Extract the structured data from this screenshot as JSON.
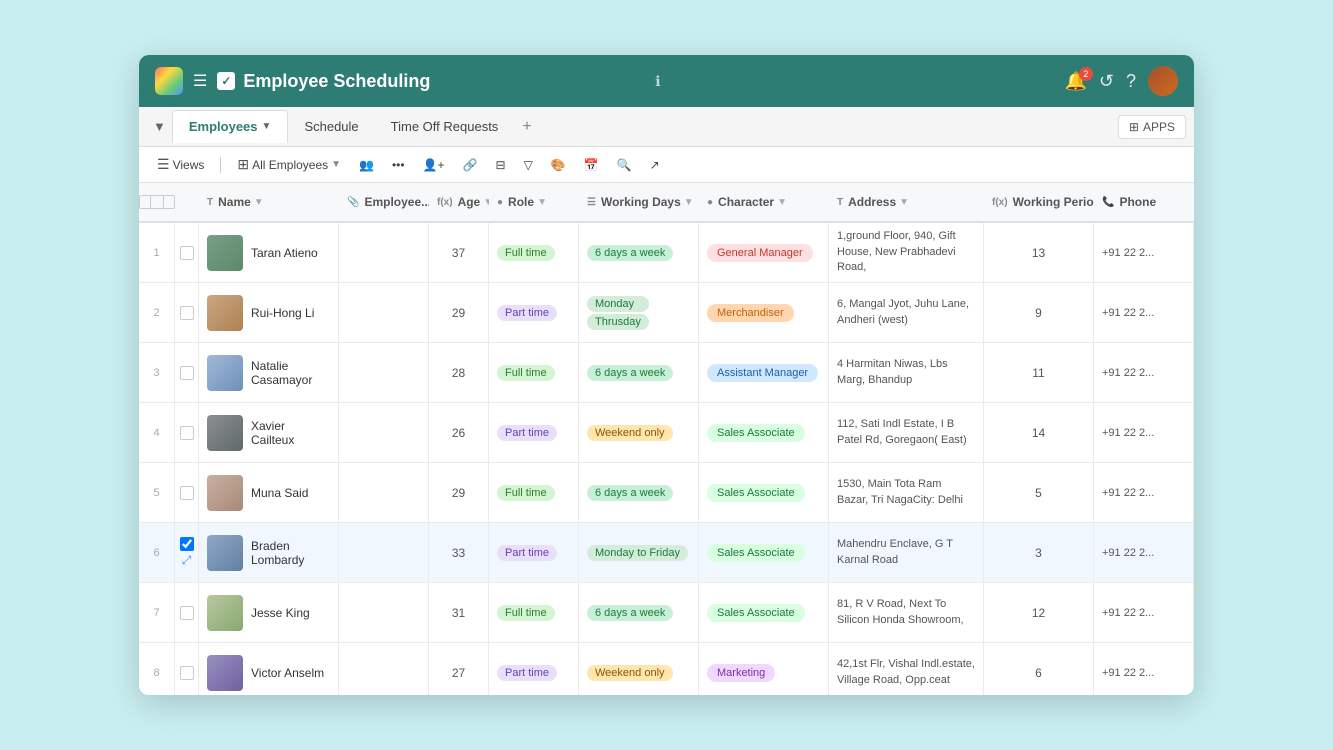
{
  "app": {
    "title": "Employee Scheduling",
    "info_icon": "ℹ",
    "notification_count": "2"
  },
  "tabs": [
    {
      "label": "Employees",
      "active": true
    },
    {
      "label": "Schedule",
      "active": false
    },
    {
      "label": "Time Off Requests",
      "active": false
    }
  ],
  "toolbar": {
    "views_label": "Views",
    "all_employees_label": "All Employees",
    "apps_label": "APPS"
  },
  "columns": [
    {
      "label": "Name",
      "type": "T"
    },
    {
      "label": "Employee...",
      "type": "📎"
    },
    {
      "label": "Age",
      "type": "f(x)"
    },
    {
      "label": "Role",
      "type": "●"
    },
    {
      "label": "Working Days",
      "type": "☰"
    },
    {
      "label": "Character",
      "type": "●"
    },
    {
      "label": "Address",
      "type": "T"
    },
    {
      "label": "Working Period",
      "type": "f(x)"
    },
    {
      "label": "Phone",
      "type": "📞"
    }
  ],
  "rows": [
    {
      "num": "1",
      "name": "Taran Atieno",
      "avatar_class": "av1",
      "age": "37",
      "role": "Full time",
      "role_class": "badge-full",
      "working_days": [
        "6 days a week"
      ],
      "working_classes": [
        "badge-days-6"
      ],
      "character": "General Manager",
      "char_class": "char-general",
      "address": "1,ground Floor, 940, Gift House, New Prabhadevi Road,",
      "period": "13",
      "phone": "+91 22 2..."
    },
    {
      "num": "2",
      "name": "Rui-Hong Li",
      "avatar_class": "av2",
      "age": "29",
      "role": "Part time",
      "role_class": "badge-part",
      "working_days": [
        "Monday",
        "Thrusday"
      ],
      "working_classes": [
        "badge-monday",
        "badge-thursday"
      ],
      "character": "Merchandiser",
      "char_class": "char-merch",
      "address": "6, Mangal Jyot, Juhu Lane, Andheri (west)",
      "period": "9",
      "phone": "+91 22 2..."
    },
    {
      "num": "3",
      "name": "Natalie Casamayor",
      "avatar_class": "av3",
      "age": "28",
      "role": "Full time",
      "role_class": "badge-full",
      "working_days": [
        "6 days a week"
      ],
      "working_classes": [
        "badge-days-6"
      ],
      "character": "Assistant Manager",
      "char_class": "char-asst",
      "address": "4 Harmitan Niwas, Lbs Marg, Bhandup",
      "period": "11",
      "phone": "+91 22 2..."
    },
    {
      "num": "4",
      "name": "Xavier Cailteux",
      "avatar_class": "av4",
      "age": "26",
      "role": "Part time",
      "role_class": "badge-part",
      "working_days": [
        "Weekend only"
      ],
      "working_classes": [
        "badge-weekend"
      ],
      "character": "Sales Associate",
      "char_class": "char-sales",
      "address": "112, Sati Indl Estate, I B Patel Rd, Goregaon( East)",
      "period": "14",
      "phone": "+91 22 2..."
    },
    {
      "num": "5",
      "name": "Muna Said",
      "avatar_class": "av5",
      "age": "29",
      "role": "Full time",
      "role_class": "badge-full",
      "working_days": [
        "6 days a week"
      ],
      "working_classes": [
        "badge-days-6"
      ],
      "character": "Sales Associate",
      "char_class": "char-sales",
      "address": "1530, Main Tota Ram Bazar, Tri NagaCity: Delhi",
      "period": "5",
      "phone": "+91 22 2..."
    },
    {
      "num": "6",
      "name": "Braden Lombardy",
      "avatar_class": "av6",
      "age": "33",
      "role": "Part time",
      "role_class": "badge-part",
      "working_days": [
        "Monday to Friday"
      ],
      "working_classes": [
        "badge-monday-friday"
      ],
      "character": "Sales Associate",
      "char_class": "char-sales",
      "address": "Mahendru Enclave, G T Karnal Road",
      "period": "3",
      "phone": "+91 22 2...",
      "selected": true
    },
    {
      "num": "7",
      "name": "Jesse King",
      "avatar_class": "av7",
      "age": "31",
      "role": "Full time",
      "role_class": "badge-full",
      "working_days": [
        "6 days a week"
      ],
      "working_classes": [
        "badge-days-6"
      ],
      "character": "Sales Associate",
      "char_class": "char-sales",
      "address": "81, R V Road, Next To Silicon Honda Showroom,",
      "period": "12",
      "phone": "+91 22 2..."
    },
    {
      "num": "8",
      "name": "Victor Anselm",
      "avatar_class": "av8",
      "age": "27",
      "role": "Part time",
      "role_class": "badge-part",
      "working_days": [
        "Weekend only"
      ],
      "working_classes": [
        "badge-weekend"
      ],
      "character": "Marketing",
      "char_class": "char-marketing",
      "address": "42,1st Flr, Vishal Indl.estate, Village Road, Opp.ceat",
      "period": "6",
      "phone": "+91 22 2..."
    }
  ],
  "add_button": "+ Add"
}
